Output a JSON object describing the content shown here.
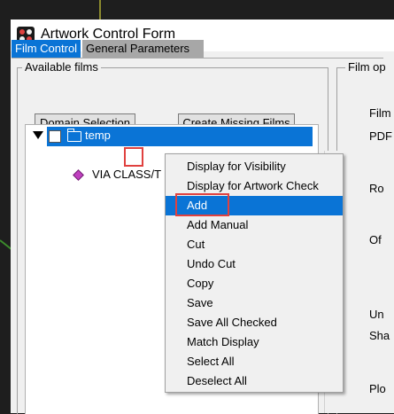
{
  "window": {
    "title": "Artwork Control Form"
  },
  "tabs": [
    {
      "label": "Film Control",
      "active": true
    },
    {
      "label": "General Parameters",
      "active": false
    }
  ],
  "available_films": {
    "group_label": "Available films",
    "domain_button": "Domain Selection",
    "create_button": "Create Missing Films",
    "tree": {
      "root_label": "temp",
      "child_label": "VIA CLASS/T"
    }
  },
  "film_options": {
    "group_label": "Film op",
    "labels": [
      "Film",
      "PDF",
      "Ro",
      "Of",
      "Un",
      "Sha",
      "Plo"
    ]
  },
  "context_menu": {
    "items": [
      "Display for Visibility",
      "Display for Artwork Check",
      "Add",
      "Add Manual",
      "Cut",
      "Undo Cut",
      "Copy",
      "Save",
      "Save All Checked",
      "Match Display",
      "Select All",
      "Deselect All"
    ],
    "selected_item": "Add"
  },
  "colors": {
    "accent": "#0a74d6",
    "highlight": "#e0413f",
    "tab_inactive": "#a7a7a7"
  }
}
